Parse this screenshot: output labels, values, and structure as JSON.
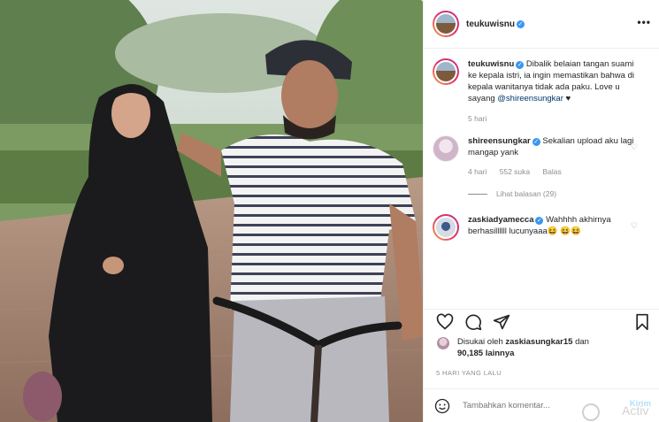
{
  "post": {
    "username": "teukuwisnu",
    "more_label": "•••"
  },
  "caption": {
    "username": "teukuwisnu",
    "text": "Dibalik belaian tangan suami ke kepala istri, ia ingin memastikan bahwa di kepala wanitanya tidak ada paku. Love u sayang",
    "mention": "@shireensungkar",
    "heart": "♥",
    "time": "5 hari"
  },
  "comments": [
    {
      "username": "shireensungkar",
      "text": "Sekalian upload aku lagi mangap yank",
      "time": "4 hari",
      "likes": "552 suka",
      "reply": "Balas",
      "view_replies": "Lihat balasan (29)"
    },
    {
      "username": "zaskiadyamecca",
      "text": "Wahhhh akhirnya berhasillllll lucunyaaa😆 😆😆"
    }
  ],
  "likes": {
    "prefix": "Disukai oleh",
    "user": "zaskiasungkar15",
    "middle": "dan",
    "count": "90,185 lainnya"
  },
  "timestamp": "5 HARI YANG LALU",
  "add_comment": {
    "placeholder": "Tambahkan komentar...",
    "send_label": "Kirim"
  },
  "watermark": "Activ"
}
